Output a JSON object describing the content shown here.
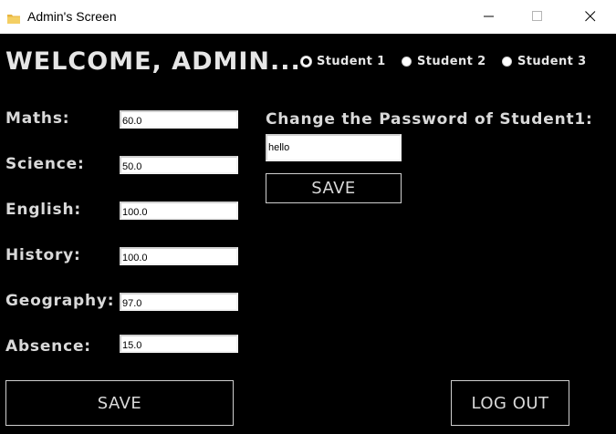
{
  "window": {
    "title": "Admin's Screen",
    "icon": "folder-icon"
  },
  "header": {
    "welcome": "WELCOME, ADMIN..."
  },
  "students": [
    {
      "label": "Student 1",
      "selected": true
    },
    {
      "label": "Student 2",
      "selected": false
    },
    {
      "label": "Student 3",
      "selected": false
    }
  ],
  "subjects": [
    {
      "label": "Maths:",
      "value": "60.0"
    },
    {
      "label": "Science:",
      "value": "50.0"
    },
    {
      "label": "English:",
      "value": "100.0"
    },
    {
      "label": "History:",
      "value": "100.0"
    },
    {
      "label": "Geography:",
      "value": "97.0"
    },
    {
      "label": "Absence:",
      "value": "15.0"
    }
  ],
  "password": {
    "label": "Change the Password of Student1:",
    "value": "hello",
    "save_label": "SAVE"
  },
  "footer": {
    "save_label": "SAVE",
    "logout_label": "LOG OUT"
  },
  "colors": {
    "background": "#000000",
    "text": "#d9d9d9",
    "titlebar": "#ffffff",
    "folder": "#e8b640"
  }
}
